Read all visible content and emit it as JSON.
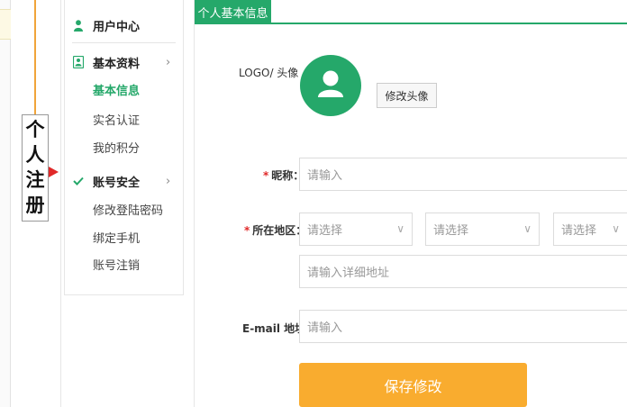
{
  "annotation": {
    "chars": [
      "个",
      "人",
      "注",
      "册"
    ]
  },
  "sidebar": {
    "user_center": "用户中心",
    "basic_profile": {
      "label": "基本资料",
      "chevron": "›"
    },
    "basic_profile_items": [
      "基本信息",
      "实名认证",
      "我的积分"
    ],
    "account_security": {
      "label": "账号安全",
      "chevron": "›"
    },
    "account_security_items": [
      "修改登陆密码",
      "绑定手机",
      "账号注销"
    ],
    "accent_color": "#25a86a"
  },
  "main": {
    "tab": "个人基本信息",
    "avatar": {
      "label": "LOGO/ 头像",
      "change_button": "修改头像"
    },
    "nickname": {
      "required": "*",
      "label": "昵称：",
      "placeholder": "请输入"
    },
    "region": {
      "required": "*",
      "label": "所在地区：",
      "selects": [
        "请选择",
        "请选择",
        "请选择"
      ],
      "select_arrow": "∨",
      "address_placeholder": "请输入详细地址"
    },
    "email": {
      "label": "E-mail 地址：",
      "placeholder": "请输入"
    },
    "save_button": "保存修改",
    "save_color": "#f9ac2f"
  }
}
